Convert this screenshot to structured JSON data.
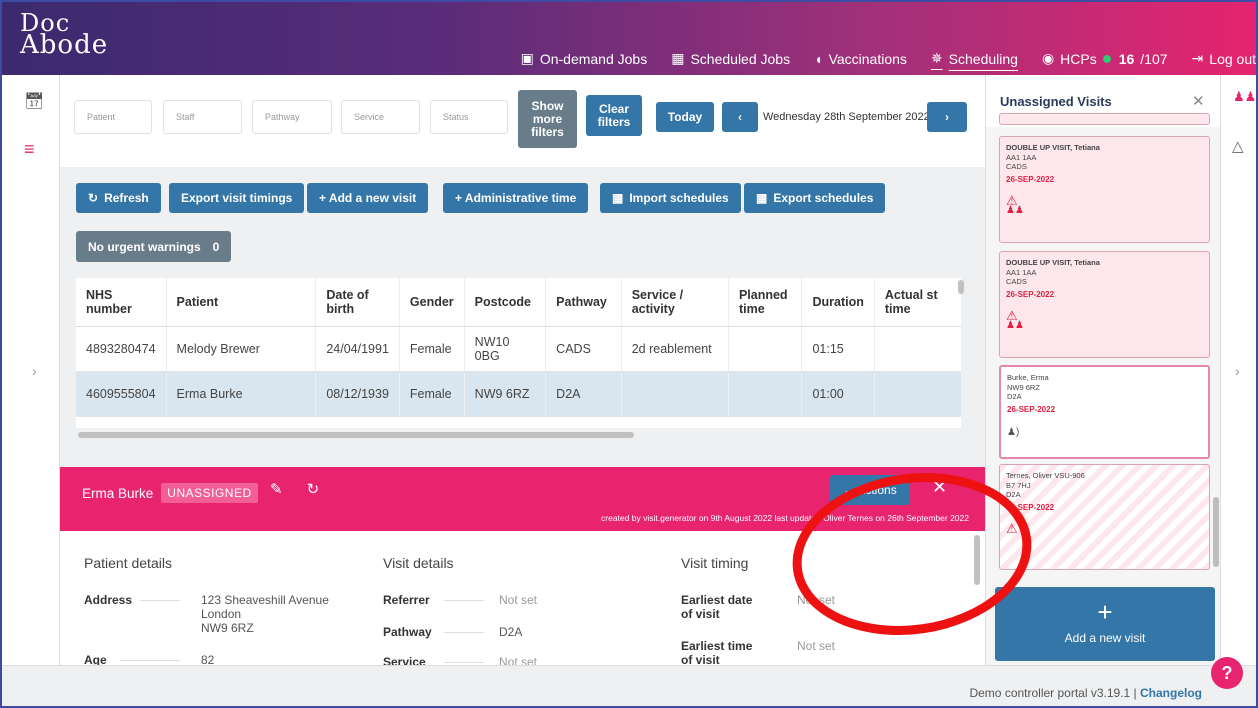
{
  "brand": {
    "logo_top": "Doc",
    "logo_bottom": "Abode"
  },
  "nav": [
    {
      "label": "On-demand Jobs",
      "icon": "briefcase-icon",
      "glyph": "▣"
    },
    {
      "label": "Scheduled Jobs",
      "icon": "calendar-icon",
      "glyph": "▦"
    },
    {
      "label": "Vaccinations",
      "icon": "shield-icon",
      "glyph": "◖"
    },
    {
      "label": "Scheduling",
      "icon": "sun-icon",
      "glyph": "✵"
    },
    {
      "label": "HCPs",
      "icon": "user-circle-icon",
      "glyph": "◉",
      "online": "16",
      "total": "/107"
    },
    {
      "label": "Log out",
      "icon": "logout-icon",
      "glyph": "⇥"
    }
  ],
  "filters": {
    "patient": "Patient",
    "staff": "Staff",
    "pathway": "Pathway",
    "service": "Service",
    "status": "Status",
    "more": "Show more filters",
    "clear": "Clear filters",
    "today": "Today",
    "date": "Wednesday 28th September 2022"
  },
  "toolbar": {
    "refresh": "Refresh",
    "export_timings": "Export visit timings",
    "add_visit": "+ Add a new visit",
    "admin_time": "+ Administrative time",
    "import": "Import schedules",
    "export": "Export schedules",
    "warnings": "No urgent warnings",
    "warnings_count": "0"
  },
  "table": {
    "headers": [
      "NHS number",
      "Patient",
      "Date of birth",
      "Gender",
      "Postcode",
      "Pathway",
      "Service / activity",
      "Planned time",
      "Duration",
      "Actual st time"
    ],
    "rows": [
      [
        "4893280474",
        "Melody Brewer",
        "24/04/1991",
        "Female",
        "NW10 0BG",
        "CADS",
        "2d reablement",
        "",
        "01:15",
        ""
      ],
      [
        "4609555804",
        "Erma Burke",
        "08/12/1939",
        "Female",
        "NW9 6RZ",
        "D2A",
        "",
        "",
        "01:00",
        ""
      ]
    ]
  },
  "panel": {
    "name": "Erma Burke",
    "status": "UNASSIGNED",
    "actions": "Actions",
    "meta": "created by visit.generator on 9th August 2022   last updated Oliver Ternes on 26th September 2022"
  },
  "details": {
    "patient_title": "Patient details",
    "visit_title": "Visit details",
    "timing_title": "Visit timing",
    "address_label": "Address",
    "address_l1": "123 Sheaveshill Avenue",
    "address_l2": "London",
    "address_l3": "NW9 6RZ",
    "age_label": "Age",
    "age": "82",
    "referrer_label": "Referrer",
    "referrer": "Not set",
    "pathway_label": "Pathway",
    "pathway": "D2A",
    "service_label": "Service",
    "service": "Not set",
    "earliest_date_label": "Earliest date of visit",
    "earliest_date": "Not set",
    "earliest_time_label": "Earliest time of visit",
    "earliest_time": "Not set"
  },
  "sidepanel": {
    "title": "Unassigned Visits",
    "cards": [
      {
        "title": "DOUBLE UP VISIT, Tetiana",
        "postcode": "AA1 1AA",
        "pathway": "CADS",
        "date": "26-SEP-2022"
      },
      {
        "title": "DOUBLE UP VISIT, Tetiana",
        "postcode": "AA1 1AA",
        "pathway": "CADS",
        "date": "26-SEP-2022"
      },
      {
        "title": "Burke, Erma",
        "postcode": "NW9 6RZ",
        "pathway": "D2A",
        "date": "26-SEP-2022"
      },
      {
        "title": "Ternes, Oliver VSU-906",
        "postcode": "B7 7HJ",
        "pathway": "D2A",
        "date": "30-SEP-2022"
      }
    ],
    "add": "Add a new visit"
  },
  "footer": {
    "version": "Demo controller portal v3.19.1 | ",
    "changelog": "Changelog"
  },
  "colors": {
    "accent": "#e8246e",
    "button": "#3576a8",
    "annotation": "#ee1111"
  }
}
